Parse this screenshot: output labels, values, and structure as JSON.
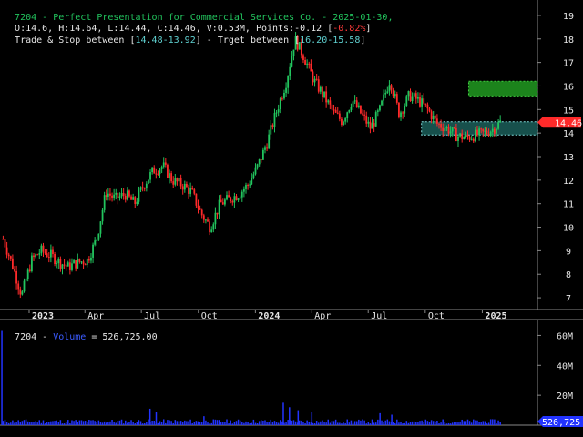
{
  "header": {
    "title_line": "7204 - Perfect Presentation for Commercial Services Co. - 2025-01-30,",
    "ohlc_prefix": "O:14.6, H:14.64, L:14.44, C:14.46, V:0.53M, Points:-0.12 [",
    "ohlc_change": "-0.82%",
    "ohlc_suffix": "]",
    "trade_prefix": "Trade & Stop between [",
    "trade_range": "14.48-13.92",
    "target_mid": "] - Trget between [",
    "target_range": "16.20-15.58",
    "target_suffix": "]"
  },
  "volume_panel": {
    "label_prefix": "7204 - ",
    "label_series": "Volume",
    "label_suffix": " = 526,725.00"
  },
  "colors": {
    "background": "#000000",
    "up": "#22c55e",
    "down": "#ff2a2a",
    "volume": "#2233ff",
    "trade_zone": "#1f6b66",
    "target_zone": "#1e8a1e",
    "price_badge": "#ff2a2a"
  },
  "chart_data": [
    {
      "type": "candlestick",
      "symbol": "7204",
      "last_price_label": "14.46",
      "x_tick_labels": [
        "2023",
        "Apr",
        "Jul",
        "Oct",
        "2024",
        "Apr",
        "Jul",
        "Oct",
        "2025"
      ],
      "x_tick_dates": [
        "2023-01-01",
        "2023-04-01",
        "2023-07-01",
        "2023-10-01",
        "2024-01-01",
        "2024-04-01",
        "2024-07-01",
        "2024-10-01",
        "2025-01-01"
      ],
      "x_range": [
        "2022-11-15",
        "2025-03-31"
      ],
      "y_tick_labels": [
        "7",
        "8",
        "9",
        "10",
        "11",
        "12",
        "13",
        "14",
        "15",
        "16",
        "17",
        "18",
        "19"
      ],
      "ylim": [
        6.5,
        19.5
      ],
      "trade_zone": {
        "low": 13.92,
        "high": 14.48,
        "start": "2024-09-25"
      },
      "target_zone": {
        "low": 15.58,
        "high": 16.2,
        "start": "2024-12-10"
      },
      "close_series": {
        "dates": [
          "2022-11-20",
          "2022-12-05",
          "2022-12-20",
          "2023-01-05",
          "2023-01-20",
          "2023-02-05",
          "2023-02-20",
          "2023-03-05",
          "2023-03-20",
          "2023-04-05",
          "2023-04-20",
          "2023-05-05",
          "2023-05-20",
          "2023-06-05",
          "2023-06-20",
          "2023-07-05",
          "2023-07-20",
          "2023-08-05",
          "2023-08-20",
          "2023-09-05",
          "2023-09-20",
          "2023-10-05",
          "2023-10-20",
          "2023-11-05",
          "2023-11-20",
          "2023-12-05",
          "2023-12-20",
          "2024-01-05",
          "2024-01-20",
          "2024-02-05",
          "2024-02-20",
          "2024-03-05",
          "2024-03-20",
          "2024-04-05",
          "2024-04-20",
          "2024-05-05",
          "2024-05-20",
          "2024-06-05",
          "2024-06-20",
          "2024-07-05",
          "2024-07-20",
          "2024-08-05",
          "2024-08-20",
          "2024-09-05",
          "2024-09-20",
          "2024-10-05",
          "2024-10-20",
          "2024-11-05",
          "2024-11-20",
          "2024-12-05",
          "2024-12-20",
          "2025-01-05",
          "2025-01-20",
          "2025-01-30"
        ],
        "values": [
          9.5,
          8.4,
          7.1,
          8.6,
          9.0,
          8.8,
          8.5,
          8.3,
          8.5,
          8.6,
          9.5,
          11.5,
          11.2,
          11.4,
          11.0,
          11.8,
          12.4,
          12.6,
          12.0,
          11.8,
          11.5,
          10.6,
          10.0,
          11.0,
          11.2,
          11.4,
          11.8,
          12.6,
          13.6,
          15.0,
          16.2,
          18.0,
          17.2,
          16.2,
          15.6,
          14.9,
          14.5,
          15.4,
          14.8,
          14.2,
          15.0,
          16.3,
          14.8,
          15.6,
          15.4,
          15.0,
          14.4,
          14.2,
          13.9,
          13.8,
          13.9,
          14.0,
          14.2,
          14.46
        ]
      }
    },
    {
      "type": "bar",
      "series_name": "Volume",
      "last_value_label": "526,725",
      "y_tick_labels": [
        "20M",
        "40M",
        "60M"
      ],
      "ylim": [
        0,
        70000000
      ],
      "spikes": {
        "dates": [
          "2022-11-18",
          "2023-07-15",
          "2023-07-25",
          "2023-10-10",
          "2024-02-15",
          "2024-02-25",
          "2024-03-10",
          "2024-04-01",
          "2024-07-20",
          "2024-08-08"
        ],
        "values": [
          63000000,
          11000000,
          9000000,
          6000000,
          15000000,
          12000000,
          10000000,
          9000000,
          8000000,
          7000000
        ]
      },
      "base_volume": 2500000
    }
  ]
}
